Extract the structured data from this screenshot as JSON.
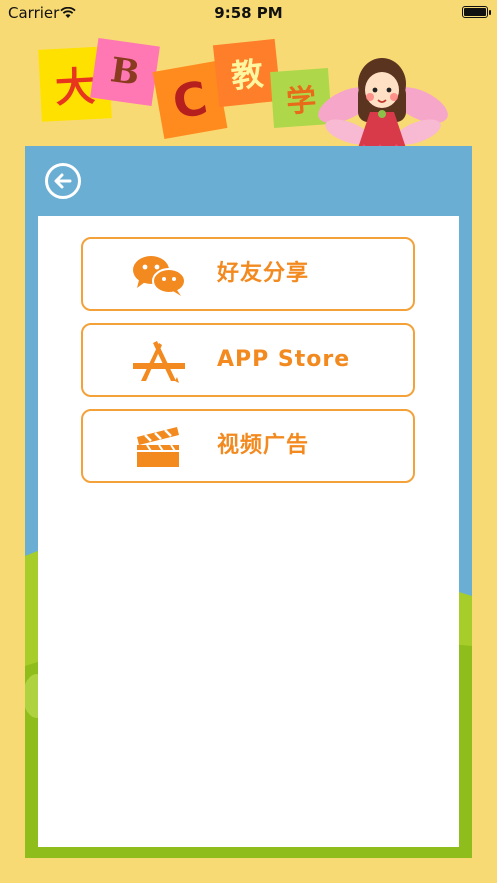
{
  "status_bar": {
    "carrier": "Carrier",
    "time": "9:58 PM"
  },
  "logo": {
    "tiles": [
      {
        "text": "大",
        "bg": "#ffe100",
        "color": "#e8351e"
      },
      {
        "text": "B",
        "bg": "#ff78b3",
        "color": "#8a3a1f"
      },
      {
        "text": "C",
        "bg": "#ff8a1e",
        "color": "#b5201f"
      },
      {
        "text": "教",
        "bg": "#ff7e2a",
        "color": "#fff6a0"
      },
      {
        "text": "学",
        "bg": "#aed84a",
        "color": "#e86a1a"
      }
    ]
  },
  "menu": {
    "items": [
      {
        "label": "好友分享",
        "icon": "wechat-icon"
      },
      {
        "label": "APP Store",
        "icon": "app-store-icon"
      },
      {
        "label": "视频广告",
        "icon": "clapperboard-icon"
      }
    ]
  },
  "colors": {
    "accent": "#f28a20",
    "panel": "#6aaed3",
    "background": "#f8da74",
    "grass": "#8fbe1c"
  }
}
